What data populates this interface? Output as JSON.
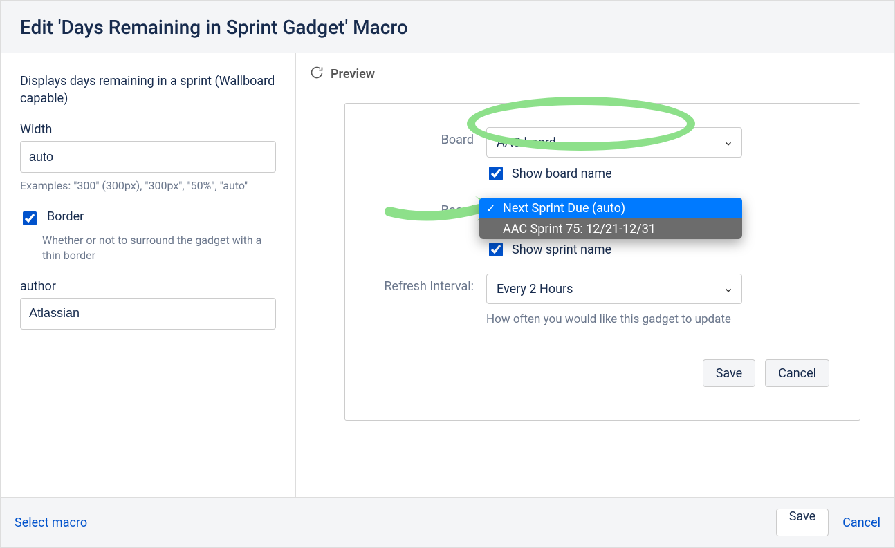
{
  "dialog": {
    "title": "Edit 'Days Remaining in Sprint Gadget' Macro"
  },
  "left": {
    "description": "Displays days remaining in a sprint (Wallboard capable)",
    "width_label": "Width",
    "width_value": "auto",
    "width_help": "Examples: \"300\" (300px), \"300px\", \"50%\", \"auto\"",
    "border_label": "Border",
    "border_checked": true,
    "border_help": "Whether or not to surround the gadget with a thin border",
    "author_label": "author",
    "author_value": "Atlassian"
  },
  "preview": {
    "header": "Preview",
    "board_label": "Board",
    "board_value": "AAC board",
    "show_board_label": "Show board name",
    "show_board_checked": true,
    "board2_label": "Board",
    "sprint_options": [
      {
        "label": "Next Sprint Due (auto)",
        "selected": true
      },
      {
        "label": "AAC Sprint 75: 12/21-12/31",
        "selected": false
      }
    ],
    "show_sprint_label": "Show sprint name",
    "refresh_label": "Refresh Interval:",
    "refresh_value": "Every 2 Hours",
    "refresh_help": "How often you would like this gadget to update",
    "save_label": "Save",
    "cancel_label": "Cancel"
  },
  "footer": {
    "select_macro": "Select macro",
    "save": "Save",
    "cancel": "Cancel"
  }
}
